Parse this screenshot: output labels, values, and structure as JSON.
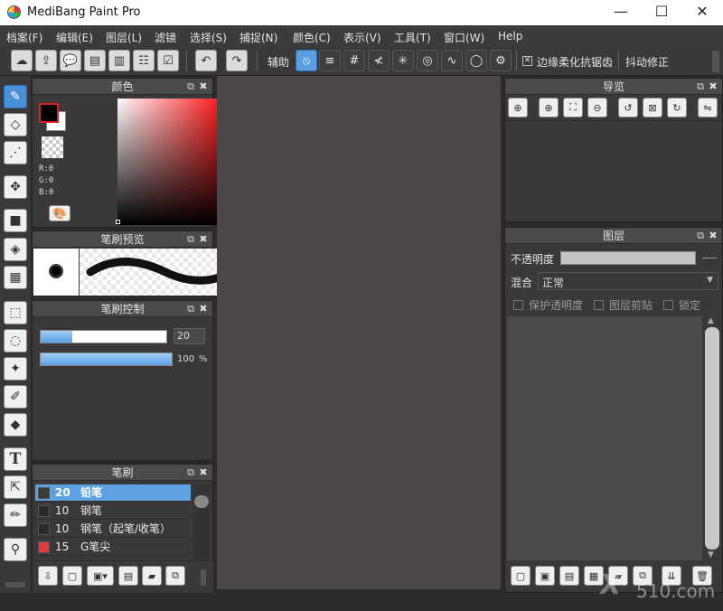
{
  "window": {
    "title": "MediBang Paint Pro",
    "minimize": "—",
    "maximize": "☐",
    "close": "✕"
  },
  "menu": [
    "档案(F)",
    "编辑(E)",
    "图层(L)",
    "滤镜",
    "选择(S)",
    "捕捉(N)",
    "颜色(C)",
    "表示(V)",
    "工具(T)",
    "窗口(W)",
    "Help"
  ],
  "toolbar": {
    "assist_label": "辅助",
    "antialias_label": "边缘柔化抗锯齿",
    "stabilizer_label": "抖动修正",
    "antialias_checked": true
  },
  "panels": {
    "color": {
      "title": "颜色",
      "r": "R:0",
      "g": "G:0",
      "b": "B:0",
      "foreground": "#000000",
      "background": "#ffffff"
    },
    "brush_preview": {
      "title": "笔刷预览"
    },
    "brush_control": {
      "title": "笔刷控制",
      "size": "20",
      "opacity": "100",
      "opacity_unit": "%",
      "size_fraction": 0.25,
      "opacity_fraction": 1.0
    },
    "brush": {
      "title": "笔刷",
      "items": [
        {
          "size": "20",
          "name": "铅笔",
          "color": "#3a3a3a",
          "selected": true
        },
        {
          "size": "10",
          "name": "钢笔",
          "color": "#2a2a2a",
          "selected": false
        },
        {
          "size": "10",
          "name": "钢笔（起笔/收笔）",
          "color": "#2a2a2a",
          "selected": false
        },
        {
          "size": "15",
          "name": "G笔尖",
          "color": "#e33b3b",
          "selected": false
        }
      ]
    },
    "navigator": {
      "title": "导览"
    },
    "layers": {
      "title": "图层",
      "opacity_label": "不透明度",
      "blend_label": "混合",
      "blend_value": "正常",
      "protect_alpha": "保护透明度",
      "clipping": "图层剪贴",
      "lock": "锁定"
    }
  },
  "watermark": {
    "site": "510.com"
  }
}
